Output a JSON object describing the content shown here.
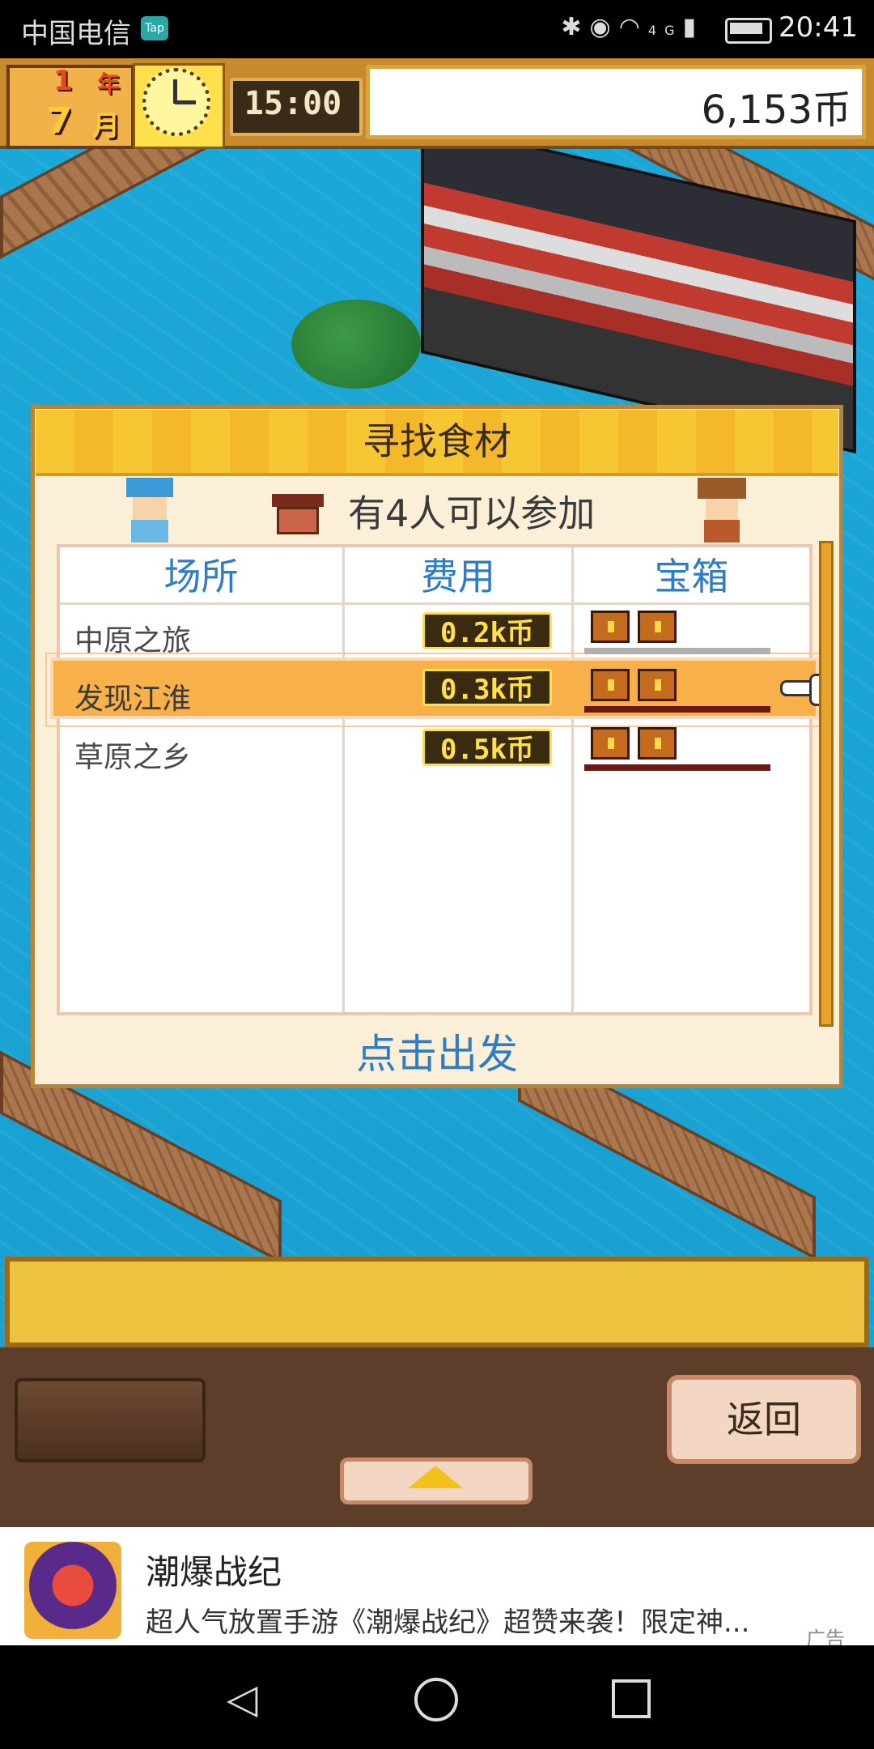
{
  "status_bar": {
    "carrier": "中国电信",
    "app_badge": "Tap",
    "network": "4G",
    "time": "20:41"
  },
  "hud": {
    "year_number": "1",
    "year_label": "年",
    "month_number": "7",
    "month_label": "月",
    "game_time": "15:00",
    "money": "6,153币"
  },
  "dialog": {
    "title": "寻找食材",
    "participants_text": "有4人可以参加",
    "columns": [
      "场所",
      "费用",
      "宝箱"
    ],
    "rows": [
      {
        "place": "中原之旅",
        "cost": "0.2k币",
        "chests": 2,
        "selected": false
      },
      {
        "place": "发现江淮",
        "cost": "0.3k币",
        "chests": 2,
        "selected": true
      },
      {
        "place": "草原之乡",
        "cost": "0.5k币",
        "chests": 2,
        "selected": false
      }
    ],
    "go_button": "点击出发"
  },
  "toolbar": {
    "back_label": "返回"
  },
  "ad": {
    "title": "潮爆战纪",
    "description": "超人气放置手游《潮爆战纪》超赞来袭！限定神...",
    "label": "广告"
  },
  "colors": {
    "accent_blue": "#2c7cc7",
    "highlight_orange": "#f8b04a",
    "header_gold": "#f7c633"
  }
}
